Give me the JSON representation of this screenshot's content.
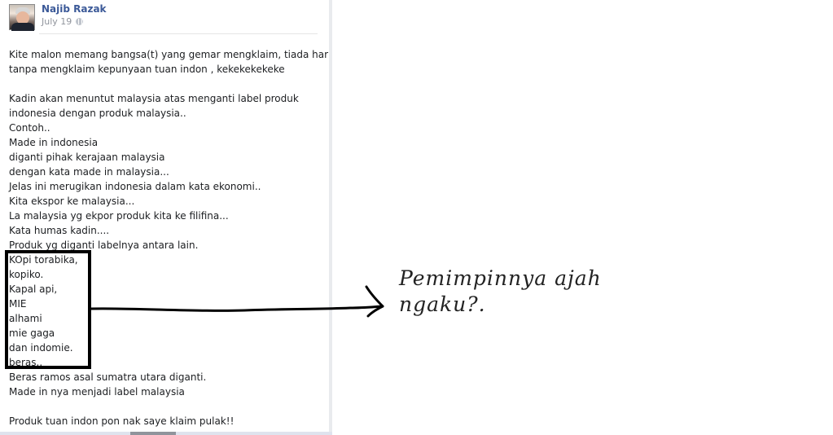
{
  "post": {
    "author": "Najib Razak",
    "date": "July 19",
    "privacy_icon": "globe-icon",
    "lines": [
      "Kite malon memang bangsa(t) yang gemar mengklaim, tiada hari",
      "tanpa mengklaim kepunyaan tuan indon , kekekekekeke",
      "",
      "Kadin akan menuntut malaysia atas menganti label produk",
      "indonesia dengan produk malaysia..",
      "Contoh..",
      "Made in indonesia",
      "diganti pihak kerajaan malaysia",
      "dengan kata made in malaysia...",
      "Jelas ini merugikan indonesia dalam kata ekonomi..",
      "Kita ekspor ke malaysia...",
      "La malaysia yg ekpor produk kita ke filifina...",
      "Kata humas kadin....",
      "Produk yg diganti labelnya antara lain.",
      "KOpi torabika,",
      "kopiko.",
      "Kapal api,",
      "MIE",
      "alhami",
      "mie gaga",
      "dan indomie.",
      "beras..",
      "Beras ramos asal sumatra utara diganti.",
      "Made in nya menjadi label malaysia",
      "",
      "Produk tuan indon pon nak saye klaim pulak!!"
    ]
  },
  "annotation": {
    "text_line1": "Pemimpinnya ajah",
    "text_line2": "ngaku?."
  }
}
